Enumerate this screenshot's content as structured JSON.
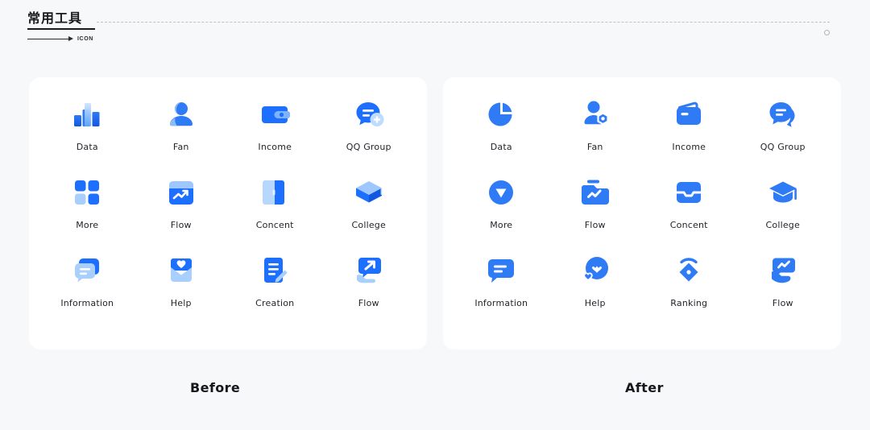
{
  "header": {
    "title": "常用工具",
    "arrow_label": "ICON"
  },
  "colors": {
    "background": "#f7f8fa",
    "card": "#ffffff",
    "brand_blue": "#1d6fff",
    "brand_blue_flat": "#2f7bf6",
    "light_blue": "#a9cffd",
    "pale_blue": "#cfe3fe",
    "label_text": "#22252a"
  },
  "panels": [
    {
      "name": "before",
      "caption": "Before",
      "items": [
        {
          "label": "Data",
          "icon": "bar-chart-icon"
        },
        {
          "label": "Fan",
          "icon": "user-icon"
        },
        {
          "label": "Income",
          "icon": "wallet-icon"
        },
        {
          "label": "QQ Group",
          "icon": "chat-add-icon"
        },
        {
          "label": "More",
          "icon": "grid-icon"
        },
        {
          "label": "Flow",
          "icon": "calendar-trend-icon"
        },
        {
          "label": "Concent",
          "icon": "book-icon"
        },
        {
          "label": "College",
          "icon": "graduation-cap-icon"
        },
        {
          "label": "Information",
          "icon": "chat-lines-icon"
        },
        {
          "label": "Help",
          "icon": "envelope-heart-icon"
        },
        {
          "label": "Creation",
          "icon": "document-pencil-icon"
        },
        {
          "label": "Flow",
          "icon": "hand-card-arrow-icon"
        }
      ]
    },
    {
      "name": "after",
      "caption": "After",
      "items": [
        {
          "label": "Data",
          "icon": "pie-chart-icon"
        },
        {
          "label": "Fan",
          "icon": "user-badge-icon"
        },
        {
          "label": "Income",
          "icon": "flat-wallet-icon"
        },
        {
          "label": "QQ Group",
          "icon": "double-chat-icon"
        },
        {
          "label": "More",
          "icon": "circle-caret-down-icon"
        },
        {
          "label": "Flow",
          "icon": "folder-zigzag-icon"
        },
        {
          "label": "Concent",
          "icon": "inbox-tray-icon"
        },
        {
          "label": "College",
          "icon": "flat-graduation-cap-icon"
        },
        {
          "label": "Information",
          "icon": "speech-bubble-icon"
        },
        {
          "label": "Help",
          "icon": "circle-heart-icon"
        },
        {
          "label": "Ranking",
          "icon": "medal-diamond-icon"
        },
        {
          "label": "Flow",
          "icon": "hand-zigzag-icon"
        }
      ]
    }
  ]
}
